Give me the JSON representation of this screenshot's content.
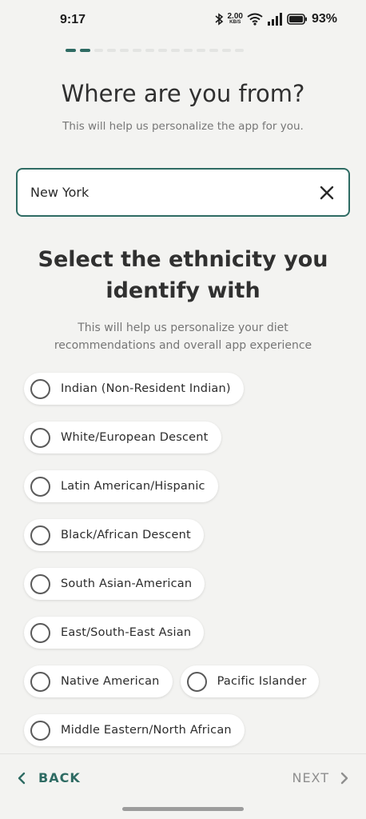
{
  "status_bar": {
    "time": "9:17",
    "net_speed_value": "2.00",
    "net_speed_unit": "KB/S",
    "battery": "93%",
    "icons": [
      "bluetooth-icon",
      "wifi-icon",
      "signal-icon",
      "battery-icon"
    ]
  },
  "progress": {
    "current_step": 2,
    "total_steps": 14
  },
  "header": {
    "title": "Where are you from?",
    "subtitle": "This will help us personalize the app for you."
  },
  "location": {
    "value": "New York",
    "clear_icon": "close-icon"
  },
  "ethnicity": {
    "title_line1": "Select the ethnicity you",
    "title_line2": "identify with",
    "subtitle_line1": "This will help us personalize your diet",
    "subtitle_line2": "recommendations and overall app experience",
    "options": [
      "Indian (Non-Resident Indian)",
      "White/European Descent",
      "Latin American/Hispanic",
      "Black/African Descent",
      "South Asian-American",
      "East/South-East Asian",
      "Native American",
      "Pacific Islander",
      "Middle Eastern/North African"
    ]
  },
  "footer": {
    "back_label": "BACK",
    "next_label": "NEXT"
  },
  "colors": {
    "accent": "#2e6b63",
    "background": "#f3f3f1",
    "disabled": "#8f8f8f"
  }
}
